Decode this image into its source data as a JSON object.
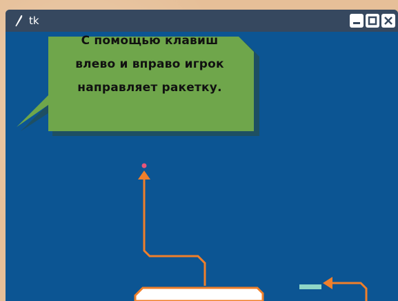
{
  "window": {
    "title": "tk",
    "title_icon": "feather-icon",
    "controls": [
      "minimize-icon",
      "maximize-icon",
      "close-icon"
    ]
  },
  "callout": {
    "lines": [
      "С помощью клавиш",
      "влево и вправо игрок",
      "направляет ракетку."
    ]
  },
  "colors": {
    "canvas_bg": "#0c5593",
    "titlebar_bg": "#36485f",
    "callout_fill": "#6fa64b",
    "arrow": "#f07f2a",
    "ball": "#e8557a",
    "paddle": "#8fd6c7"
  }
}
